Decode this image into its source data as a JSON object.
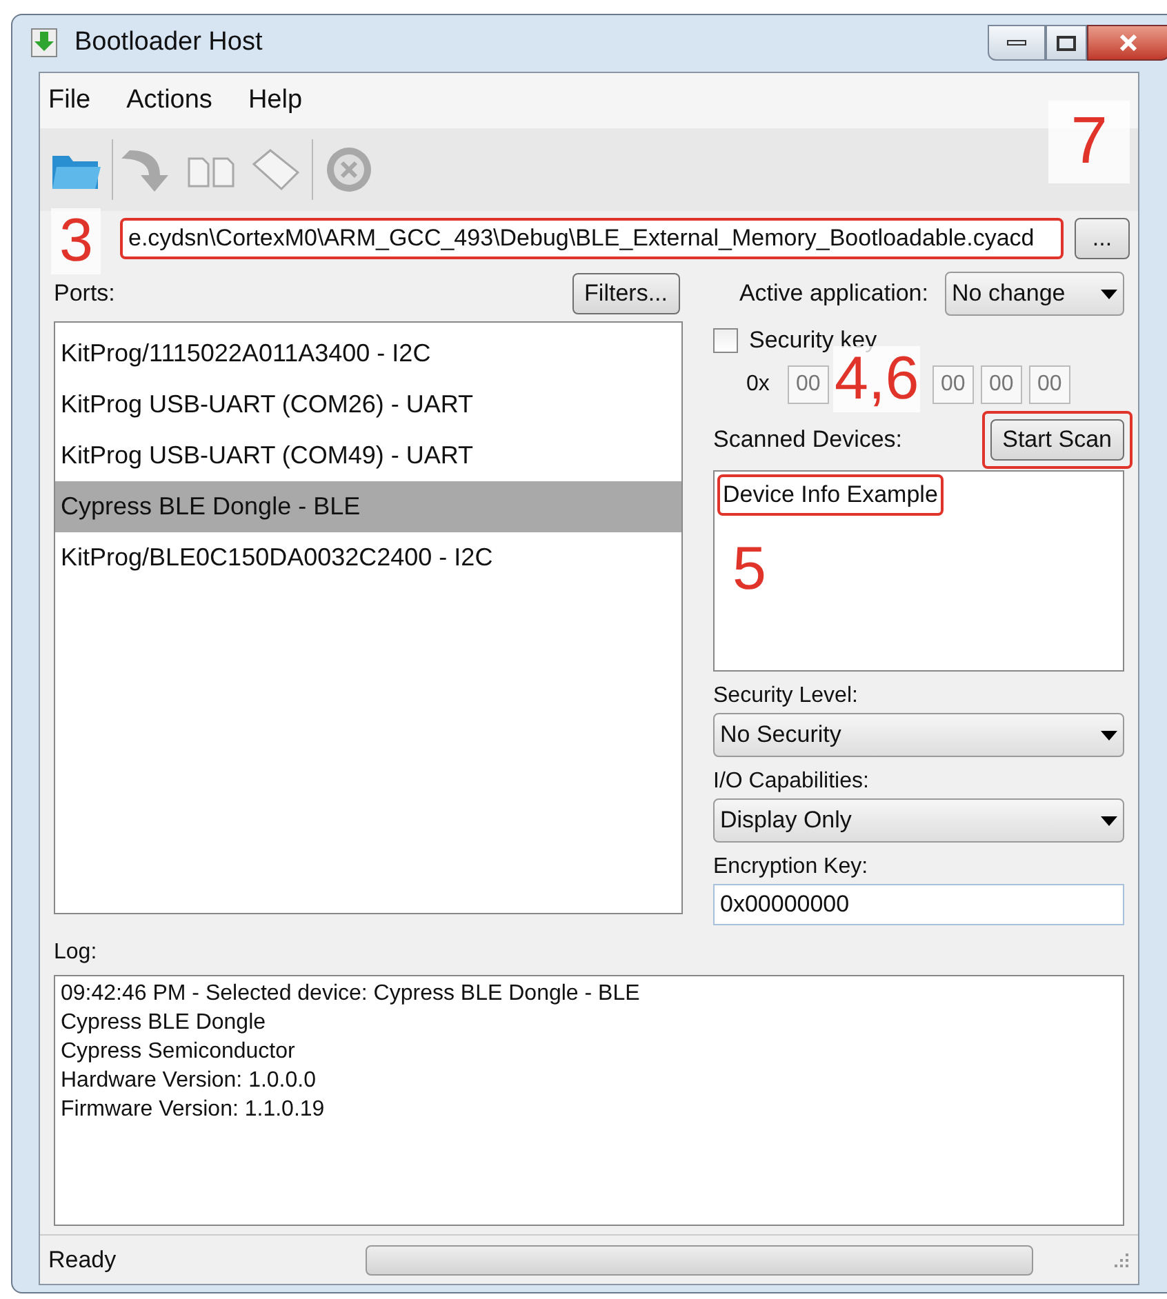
{
  "window": {
    "title": "Bootloader Host"
  },
  "menu": [
    "File",
    "Actions",
    "Help"
  ],
  "toolbar": [
    {
      "kind": "open",
      "disabled": false
    },
    {
      "kind": "program",
      "disabled": true
    },
    {
      "kind": "verify",
      "disabled": true
    },
    {
      "kind": "erase",
      "disabled": true
    },
    {
      "kind": "abort",
      "disabled": true
    }
  ],
  "file": {
    "value": "e.cydsn\\CortexM0\\ARM_GCC_493\\Debug\\BLE_External_Memory_Bootloadable.cyacd",
    "browse": "..."
  },
  "ports": {
    "label": "Ports:",
    "filters": "Filters...",
    "items": [
      {
        "name": "KitProg/1115022A011A3400 - I2C",
        "selected": false
      },
      {
        "name": "KitProg USB-UART (COM26) - UART",
        "selected": false
      },
      {
        "name": "KitProg USB-UART (COM49) - UART",
        "selected": false
      },
      {
        "name": "Cypress BLE Dongle - BLE",
        "selected": true
      },
      {
        "name": "KitProg/BLE0C150DA0032C2400 - I2C",
        "selected": false
      }
    ]
  },
  "active_application": {
    "label": "Active application:",
    "value": "No change"
  },
  "security_key": {
    "label": "Security key",
    "checked": false,
    "prefix": "0x",
    "bytes": [
      "00",
      "00",
      "00",
      "00"
    ]
  },
  "scanned_devices": {
    "label": "Scanned Devices:",
    "button": "Start Scan",
    "items": [
      "Device Info Example"
    ]
  },
  "security_level": {
    "label": "Security Level:",
    "value": "No Security"
  },
  "io_capabilities": {
    "label": "I/O Capabilities:",
    "value": "Display Only"
  },
  "encryption_key": {
    "label": "Encryption Key:",
    "value": "0x00000000"
  },
  "log": {
    "label": "Log:",
    "lines": [
      "09:42:46 PM - Selected device: Cypress BLE Dongle - BLE",
      "Cypress BLE Dongle",
      "Cypress Semiconductor",
      "Hardware Version: 1.0.0.0",
      "Firmware Version: 1.1.0.19"
    ]
  },
  "status_bar": {
    "text": "Ready",
    "level": 0
  },
  "callouts": [
    "3",
    "7",
    "4,6",
    "5"
  ]
}
